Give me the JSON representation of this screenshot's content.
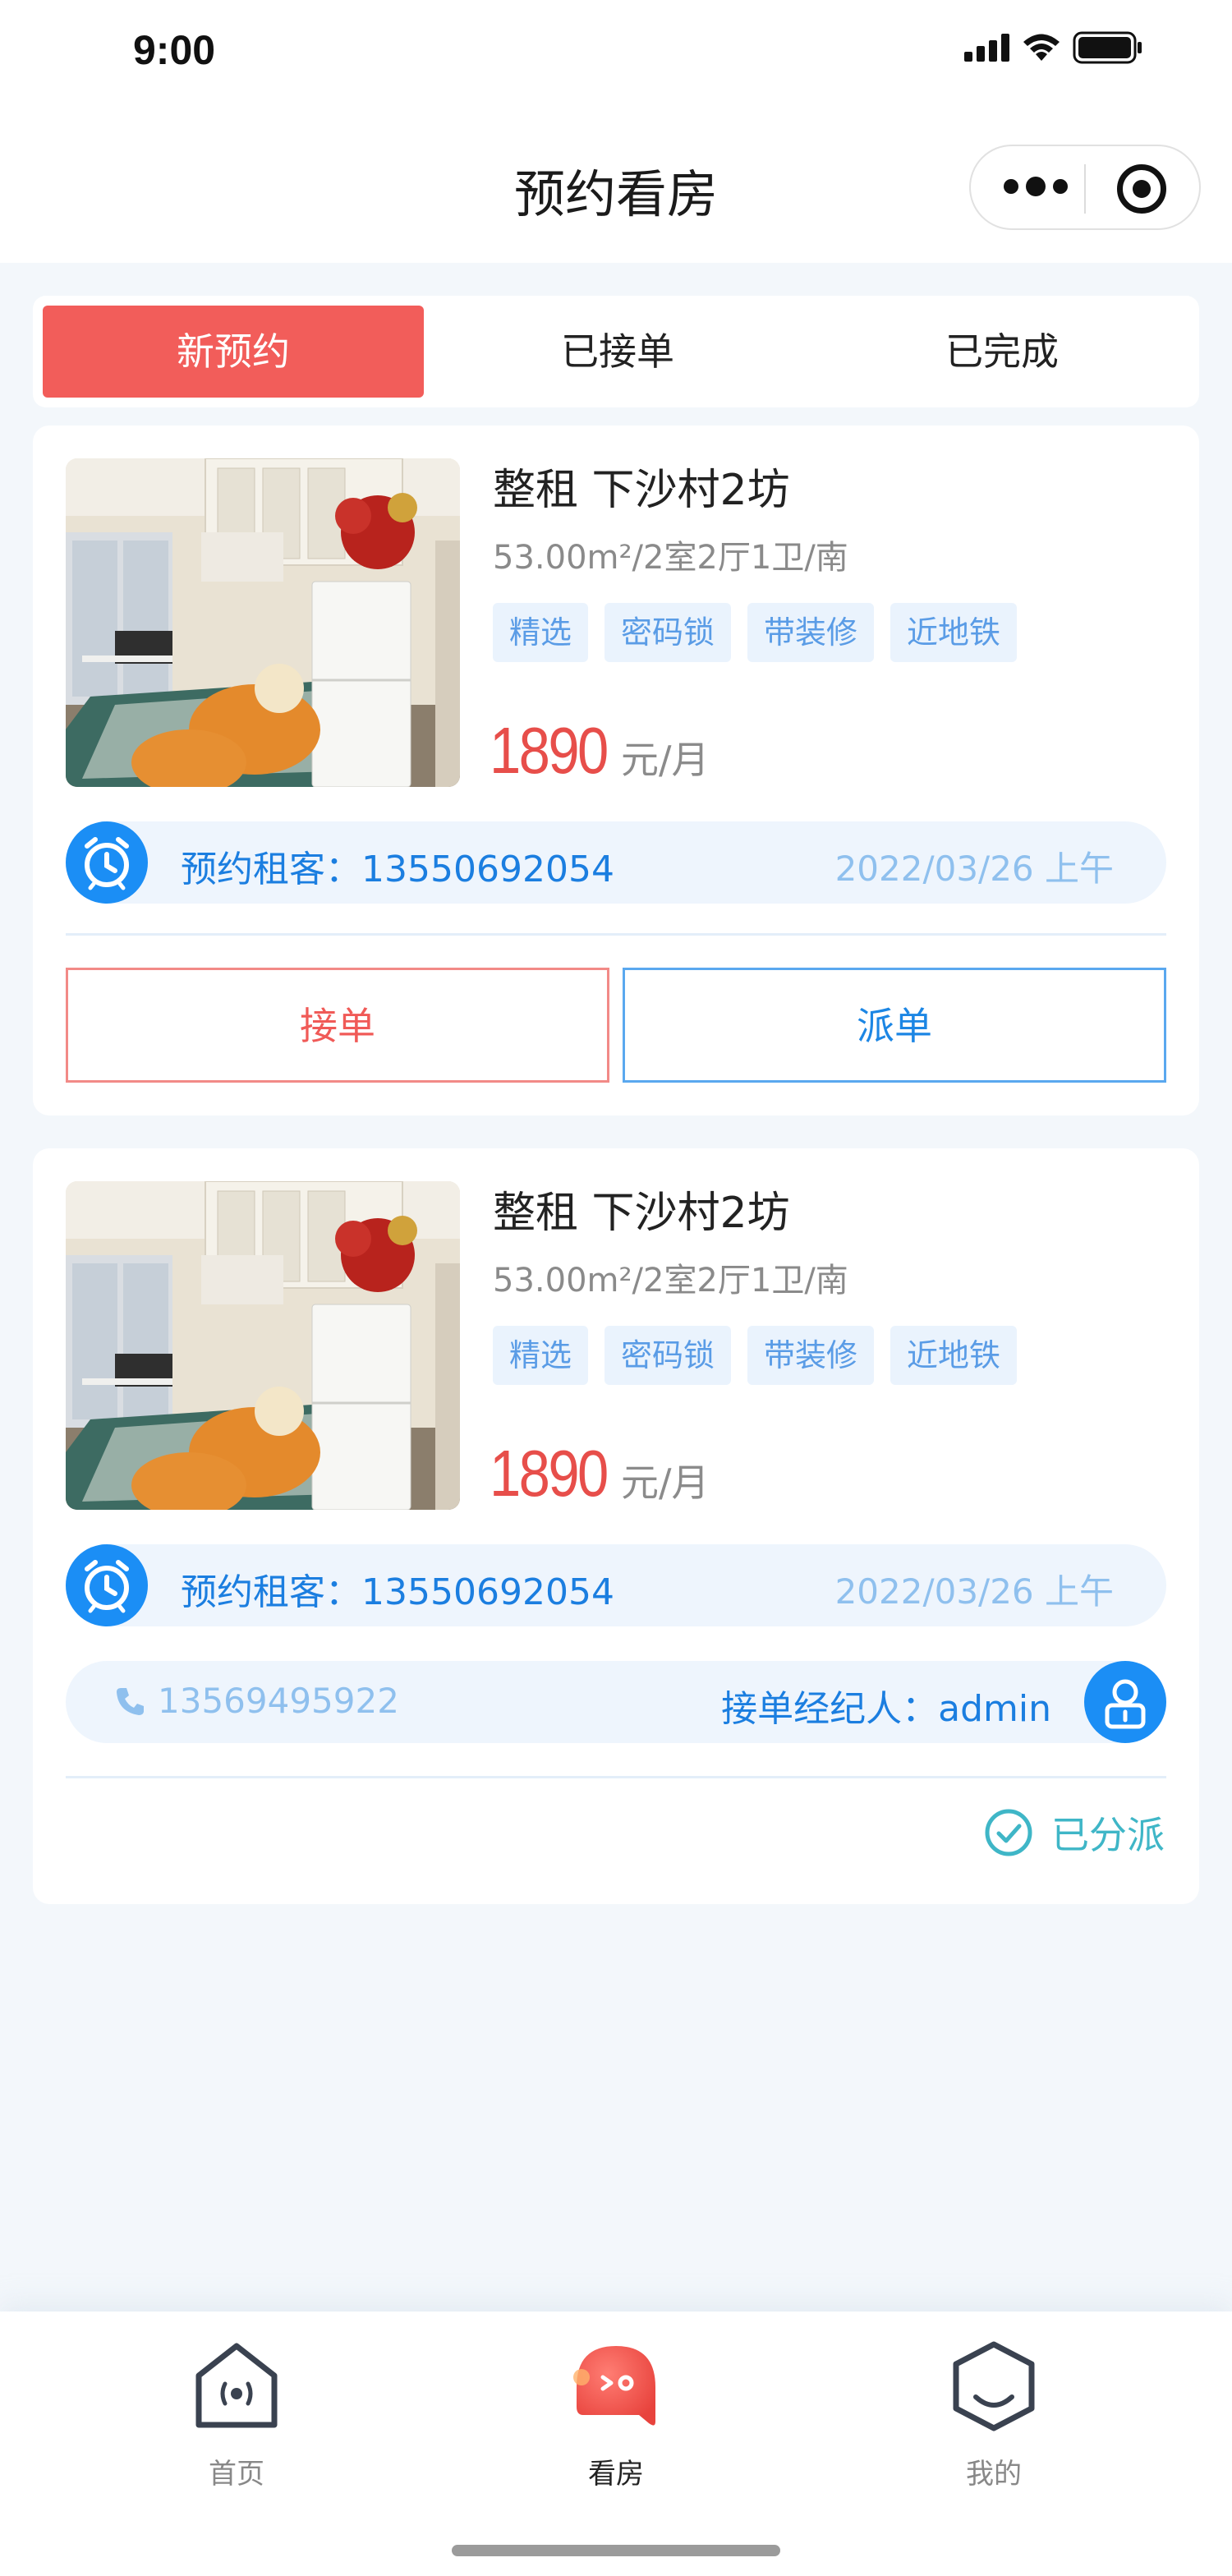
{
  "status_bar": {
    "time": "9:00"
  },
  "nav": {
    "title": "预约看房"
  },
  "tabs": [
    {
      "label": "新预约",
      "active": true
    },
    {
      "label": "已接单",
      "active": false
    },
    {
      "label": "已完成",
      "active": false
    }
  ],
  "cards": [
    {
      "title": "整租 下沙村2坊",
      "spec": "53.00m²/2室2厅1卫/南",
      "tags": [
        "精选",
        "密码锁",
        "带装修",
        "近地铁"
      ],
      "price": "1890",
      "price_unit": "元/月",
      "tenant_label": "预约租客：13550692054",
      "date": "2022/03/26 上午",
      "accept_label": "接单",
      "dispatch_label": "派单"
    },
    {
      "title": "整租 下沙村2坊",
      "spec": "53.00m²/2室2厅1卫/南",
      "tags": [
        "精选",
        "密码锁",
        "带装修",
        "近地铁"
      ],
      "price": "1890",
      "price_unit": "元/月",
      "tenant_label": "预约租客：13550692054",
      "date": "2022/03/26 上午",
      "agent_phone": "13569495922",
      "agent_label": "接单经纪人：admin",
      "status": "已分派"
    }
  ],
  "tabbar": [
    {
      "label": "首页",
      "icon": "home-icon",
      "active": false
    },
    {
      "label": "看房",
      "icon": "viewing-mascot-icon",
      "active": true
    },
    {
      "label": "我的",
      "icon": "profile-icon",
      "active": false
    }
  ],
  "colors": {
    "accent_red": "#f25d5a",
    "accent_blue": "#1b8ef5",
    "tag_bg": "#eaf3fd",
    "done_teal": "#3fb6c7",
    "page_bg": "#f3f7fb"
  }
}
